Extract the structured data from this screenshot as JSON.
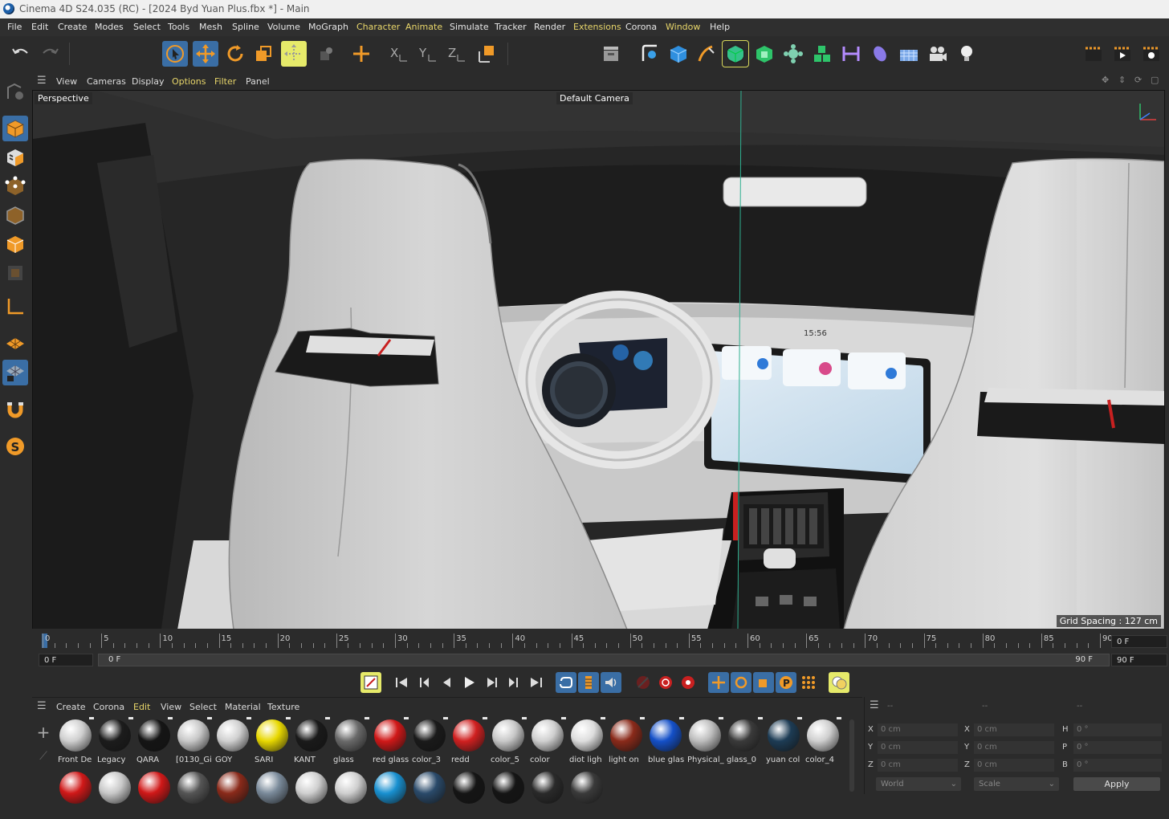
{
  "window": {
    "title": "Cinema 4D S24.035 (RC) - [2024 Byd Yuan Plus.fbx *] - Main"
  },
  "menubar": {
    "items": [
      "File",
      "Edit",
      "Create",
      "Modes",
      "Select",
      "Tools",
      "Mesh",
      "Spline",
      "Volume",
      "MoGraph",
      "Character",
      "Animate",
      "Simulate",
      "Tracker",
      "Render",
      "Extensions",
      "Corona",
      "Window",
      "Help"
    ]
  },
  "toolbar": {
    "icons": [
      "undo-icon",
      "redo-icon",
      "live-selection-icon",
      "move-icon",
      "rotate-icon",
      "scale-icon",
      "model-mode-icon",
      "axis-mode-icon",
      "add-null-icon",
      "x-axis-lock-icon",
      "y-axis-lock-icon",
      "z-axis-lock-icon",
      "coordinate-system-icon",
      "render-view-icon",
      "spline-pen-icon",
      "cube-icon",
      "pen-icon",
      "subdivision-icon",
      "extrude-icon",
      "cloner-icon",
      "array-icon",
      "deformer-icon",
      "field-icon",
      "floor-icon",
      "camera-icon",
      "light-icon",
      "render-region-icon",
      "render-icon",
      "render-settings-icon"
    ]
  },
  "viewport": {
    "menu": [
      "View",
      "Cameras",
      "Display",
      "Options",
      "Filter",
      "Panel"
    ],
    "name": "Perspective",
    "camera": "Default Camera",
    "grid_spacing": "Grid Spacing : 127 cm",
    "screen_time": "15:56"
  },
  "timeline": {
    "ticks": [
      "0",
      "5",
      "10",
      "15",
      "20",
      "25",
      "30",
      "35",
      "40",
      "45",
      "50",
      "55",
      "60",
      "65",
      "70",
      "75",
      "80",
      "85",
      "90"
    ],
    "current_frame": "0 F",
    "start_field": "0 F",
    "range_start": "0 F",
    "range_end": "90 F",
    "end_field": "90 F"
  },
  "materials": {
    "menu": [
      "Create",
      "Corona",
      "Edit",
      "View",
      "Select",
      "Material",
      "Texture"
    ],
    "row1": [
      {
        "name": "Front De",
        "color": "#cfcfcf"
      },
      {
        "name": "Legacy",
        "color": "#1c1c1c"
      },
      {
        "name": "QARA",
        "color": "#151515"
      },
      {
        "name": "[0130_Gi",
        "color": "#c8c8c8"
      },
      {
        "name": "GOY",
        "color": "#d0d0d0"
      },
      {
        "name": "SARI",
        "color": "#e8d800"
      },
      {
        "name": "KANT",
        "color": "#1a1a1a"
      },
      {
        "name": "glass",
        "color": "#6a6a6a"
      },
      {
        "name": "red glass",
        "color": "#d01818"
      },
      {
        "name": "color_3",
        "color": "#1a1a1a"
      },
      {
        "name": "redd",
        "color": "#d02020"
      },
      {
        "name": "color_5",
        "color": "#c8c8c8"
      },
      {
        "name": "color",
        "color": "#cfcfcf"
      },
      {
        "name": "diot ligh",
        "color": "#dddddd"
      },
      {
        "name": "light on",
        "color": "#8a2a1a"
      },
      {
        "name": "blue glas",
        "color": "#1450c8"
      },
      {
        "name": "Physical_",
        "color": "#bdbdbd"
      },
      {
        "name": "glass_0",
        "color": "#3a3a3a"
      },
      {
        "name": "yuan col",
        "color": "#1d3c55"
      },
      {
        "name": "color_4",
        "color": "#cfcfcf"
      }
    ],
    "row2": [
      "#d01818",
      "#c8c8c8",
      "#d01818",
      "#555555",
      "#8a2a1a",
      "#7a8a9a",
      "#cfcfcf",
      "#cfcfcf",
      "#1890d0",
      "#2a4a6a",
      "#151515",
      "#151515",
      "#2a2a2a",
      "#3a3a3a"
    ]
  },
  "coordinates": {
    "header": [
      "--",
      "--",
      "--"
    ],
    "rows": [
      {
        "a": "X",
        "av": "0 cm",
        "b": "X",
        "bv": "0 cm",
        "c": "H",
        "cv": "0 °"
      },
      {
        "a": "Y",
        "av": "0 cm",
        "b": "Y",
        "bv": "0 cm",
        "c": "P",
        "cv": "0 °"
      },
      {
        "a": "Z",
        "av": "0 cm",
        "b": "Z",
        "bv": "0 cm",
        "c": "B",
        "cv": "0 °"
      }
    ],
    "space": "World",
    "mode": "Scale",
    "apply": "Apply"
  },
  "colors": {
    "accent": "#3a6ea5",
    "highlight_text": "#e8d66a",
    "orange": "#f09a28"
  }
}
